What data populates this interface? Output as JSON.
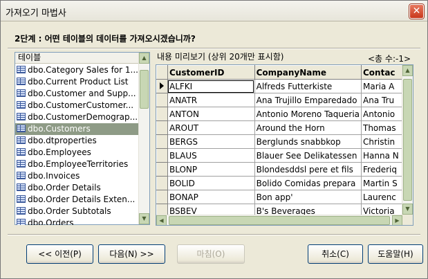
{
  "window": {
    "title": "가져오기 마법사",
    "close": "✕"
  },
  "step_title": "2단계 : 어떤 테이블의 데이터를 가져오시겠습니까?",
  "tables": {
    "header": "테이블",
    "items": [
      "dbo.Category Sales for 1...",
      "dbo.Current Product List",
      "dbo.Customer and Supp...",
      "dbo.CustomerCustomer...",
      "dbo.CustomerDemograp...",
      "dbo.Customers",
      "dbo.dtproperties",
      "dbo.Employees",
      "dbo.EmployeeTerritories",
      "dbo.Invoices",
      "dbo.Order Details",
      "dbo.Order Details Exten...",
      "dbo.Order Subtotals",
      "dbo.Orders"
    ],
    "selected": "dbo.Customers"
  },
  "preview": {
    "label": "내용 미리보기 (상위 20개만 표시함)",
    "row_count": "<총 수:-1>",
    "columns": [
      "CustomerID",
      "CompanyName",
      "Contac"
    ],
    "rows": [
      [
        "ALFKI",
        "Alfreds Futterkiste",
        "Maria A"
      ],
      [
        "ANATR",
        "Ana Trujillo Emparedado",
        "Ana Tru"
      ],
      [
        "ANTON",
        "Antonio Moreno Taqueria",
        "Antonio"
      ],
      [
        "AROUT",
        "Around the Horn",
        "Thomas"
      ],
      [
        "BERGS",
        "Berglunds snabbkop",
        "Christin"
      ],
      [
        "BLAUS",
        "Blauer See Delikatessen",
        "Hanna N"
      ],
      [
        "BLONP",
        "Blondesddsl pere et fils",
        "Frederiq"
      ],
      [
        "BOLID",
        "Bolido Comidas prepara",
        "Martin S"
      ],
      [
        "BONAP",
        "Bon app'",
        "Laurenc"
      ],
      [
        "BSBEV",
        "B's Beverages",
        "Victoria"
      ]
    ]
  },
  "buttons": {
    "prev": "<< 이전(P)",
    "next": "다음(N) >>",
    "finish": "마침(O)",
    "cancel": "취소(C)",
    "help": "도움말(H)"
  }
}
